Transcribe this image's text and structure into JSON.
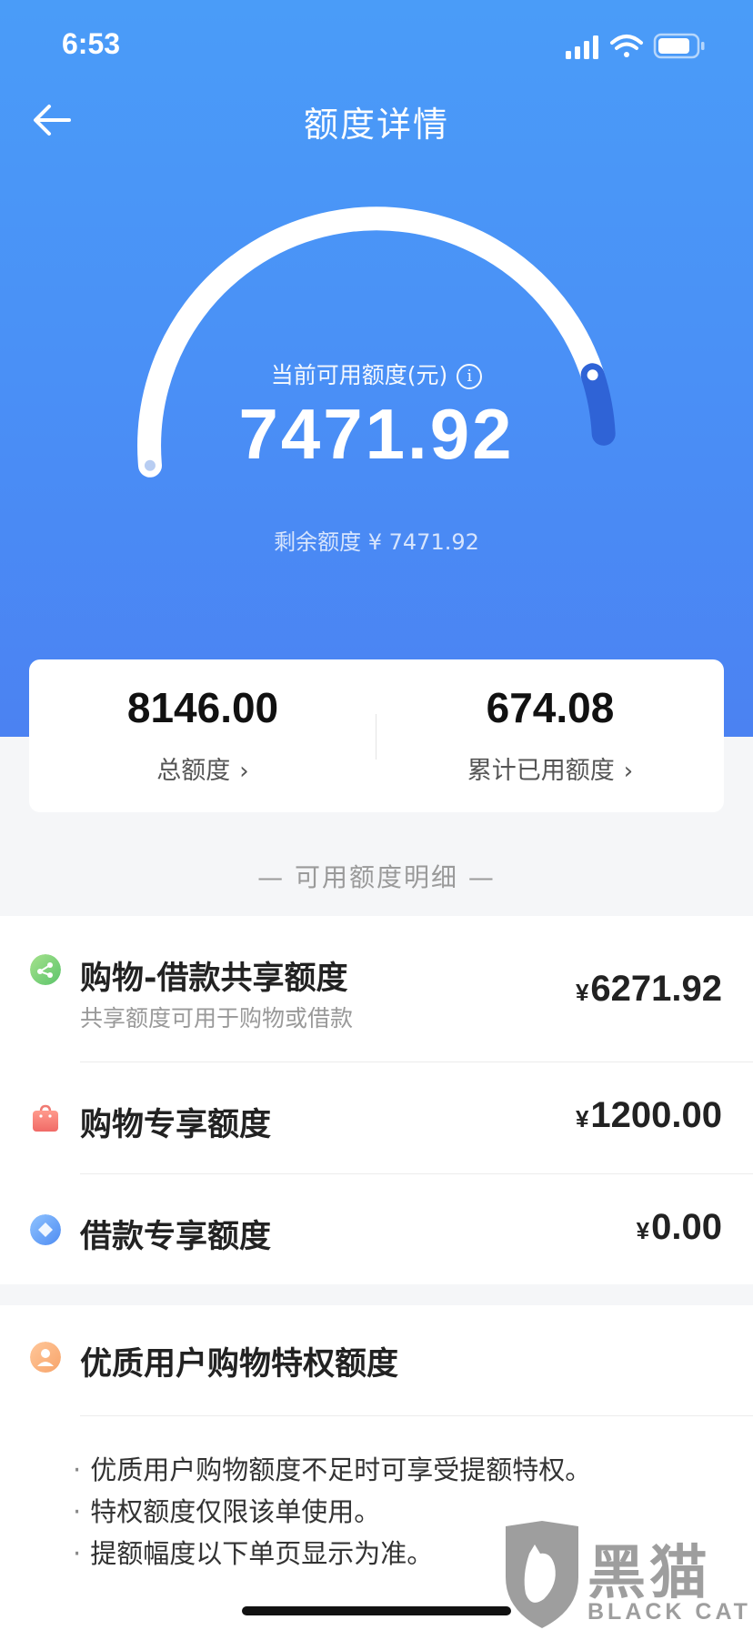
{
  "status_bar": {
    "time": "6:53"
  },
  "nav": {
    "title": "额度详情"
  },
  "gauge": {
    "label": "当前可用额度(元)",
    "value": "7471.92",
    "remaining_text": "剩余额度 ¥ 7471.92",
    "used_fraction": 0.083
  },
  "summary": {
    "total": {
      "value": "8146.00",
      "label": "总额度"
    },
    "used": {
      "value": "674.08",
      "label": "累计已用额度"
    }
  },
  "section_title": "— 可用额度明细 —",
  "quota_items": [
    {
      "title": "购物-借款共享额度",
      "subtitle": "共享额度可用于购物或借款",
      "currency": "¥",
      "amount": "6271.92",
      "icon": "share-icon"
    },
    {
      "title": "购物专享额度",
      "currency": "¥",
      "amount": "1200.00",
      "icon": "shopping-bag-icon"
    },
    {
      "title": "借款专享额度",
      "currency": "¥",
      "amount": "0.00",
      "icon": "diamond-icon"
    }
  ],
  "privilege": {
    "title": "优质用户购物特权额度",
    "icon": "user-icon",
    "notes": [
      "优质用户购物额度不足时可享受提额特权。",
      "特权额度仅限该单使用。",
      "提额幅度以下单页显示为准。"
    ]
  },
  "watermark": {
    "cn": "黑猫",
    "en": "BLACK CAT"
  },
  "colors": {
    "hero_top": "#4a9cf8",
    "hero_bottom": "#4b82f2",
    "gauge_used": "#2f63d6",
    "text_primary": "#222222",
    "text_muted": "#999999"
  }
}
